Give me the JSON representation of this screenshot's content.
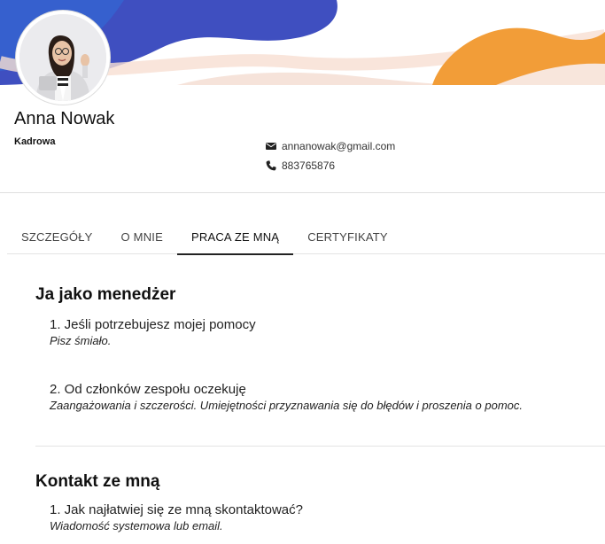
{
  "profile": {
    "name": "Anna Nowak",
    "role": "Kadrowa",
    "email": "annanowak@gmail.com",
    "phone": "883765876"
  },
  "colors": {
    "banner_blue": "#3f4fc0",
    "banner_orange": "#f29d38",
    "active_tab_indicator": "#222222"
  },
  "icons": {
    "email": "envelope-icon",
    "phone": "phone-icon"
  },
  "tabs": [
    {
      "label": "SZCZEGÓŁY",
      "active": false
    },
    {
      "label": "O MNIE",
      "active": false
    },
    {
      "label": "PRACA ZE MNĄ",
      "active": true
    },
    {
      "label": "CERTYFIKATY",
      "active": false
    }
  ],
  "manager": {
    "title": "Ja jako menedżer",
    "items": [
      {
        "question": "1. Jeśli potrzebujesz mojej pomocy",
        "answer": "Pisz śmiało."
      },
      {
        "question": "2. Od członków zespołu oczekuję",
        "answer": "Zaangażowania i szczerości. Umiejętności przyznawania się do błędów i proszenia o pomoc."
      }
    ]
  },
  "contact_section": {
    "title": "Kontakt ze mną",
    "items": [
      {
        "question": "1. Jak najłatwiej się ze mną skontaktować?",
        "answer": "Wiadomość systemowa lub email."
      }
    ]
  }
}
